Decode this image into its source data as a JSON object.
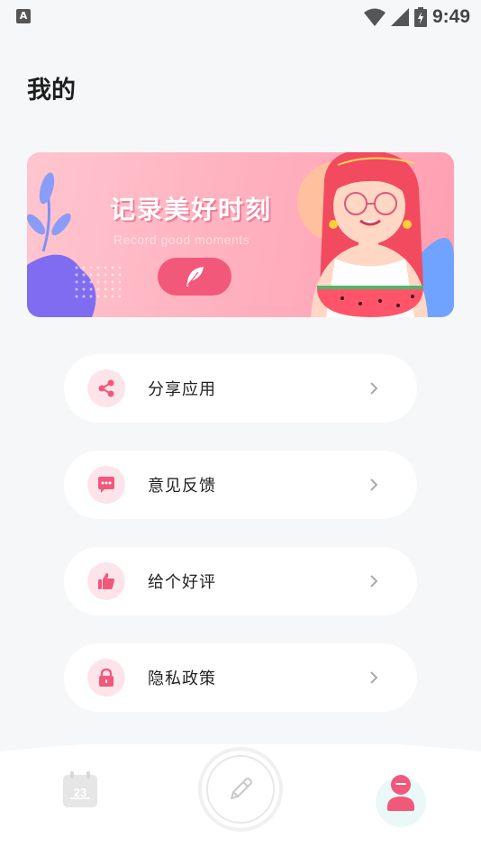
{
  "status_bar": {
    "time": "9:49",
    "app_icon_letter": "A"
  },
  "page": {
    "title": "我的"
  },
  "banner": {
    "title": "记录美好时刻",
    "subtitle": "Record good moments",
    "button_icon": "feather-icon"
  },
  "menu": {
    "items": [
      {
        "label": "分享应用",
        "icon": "share-icon"
      },
      {
        "label": "意见反馈",
        "icon": "chat-bubble-icon"
      },
      {
        "label": "给个好评",
        "icon": "thumbs-up-icon"
      },
      {
        "label": "隐私政策",
        "icon": "lock-icon"
      }
    ]
  },
  "bottom_nav": {
    "calendar_day": "23",
    "items": [
      "calendar-icon",
      "pencil-icon",
      "profile-icon"
    ]
  },
  "colors": {
    "accent": "#f2587a",
    "icon_bg": "#fde4ea",
    "background": "#f6f7f9"
  }
}
